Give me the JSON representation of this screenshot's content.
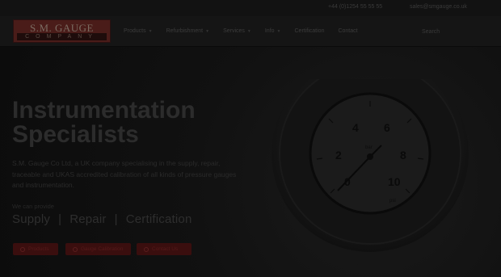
{
  "topbar": {
    "phone": "+44 (0)1254 55 55 55",
    "email": "sales@smgauge.co.uk"
  },
  "logo": {
    "line1": "S.M. GAUGE",
    "line2": "COMPANY"
  },
  "nav": {
    "items": [
      {
        "label": "Products",
        "has_dropdown": true
      },
      {
        "label": "Refurbishment",
        "has_dropdown": true
      },
      {
        "label": "Services",
        "has_dropdown": true
      },
      {
        "label": "Info",
        "has_dropdown": true
      },
      {
        "label": "Certification",
        "has_dropdown": false
      },
      {
        "label": "Contact",
        "has_dropdown": false
      }
    ],
    "search_label": "Search"
  },
  "hero": {
    "headline_line1": "Instrumentation",
    "headline_line2": "Specialists",
    "description": "S.M. Gauge Co Ltd, a UK company specialising in the supply, repair, traceable and UKAS accredited calibration of all kinds of pressure gauges and instrumentation.",
    "offer_label": "We can provide",
    "services": [
      "Supply",
      "Repair",
      "Certification"
    ],
    "buttons": [
      "Products",
      "Gauge Calibration",
      "Contact Us"
    ]
  },
  "gauge": {
    "labels": [
      "0",
      "2",
      "4",
      "6",
      "8",
      "10"
    ],
    "units": [
      "bar",
      "psi"
    ]
  },
  "colors": {
    "accent": "#3a0e0e",
    "logo_bg": "#4a1c19"
  }
}
